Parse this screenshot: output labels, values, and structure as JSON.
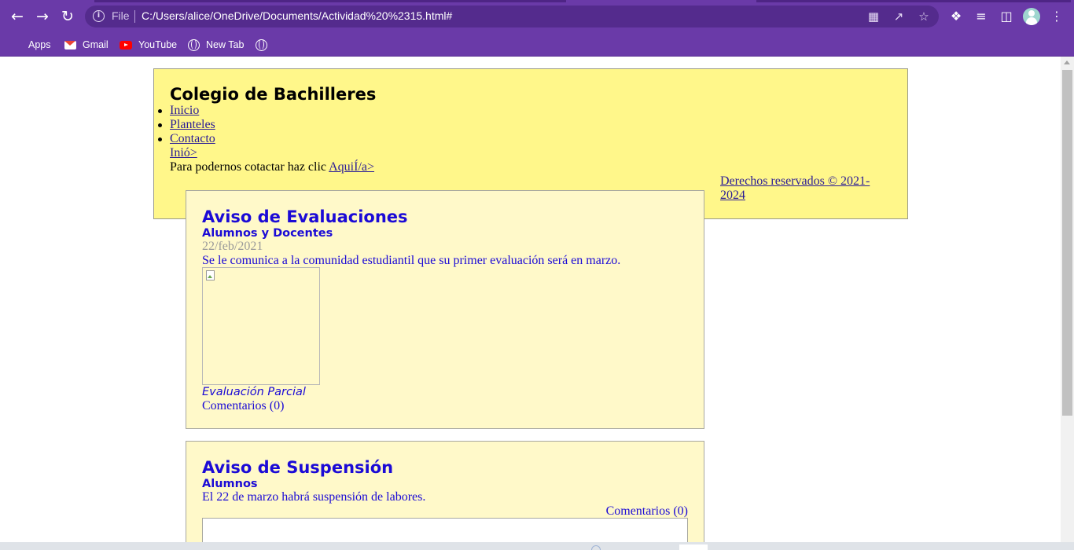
{
  "browser": {
    "file_label": "File",
    "url": "C:/Users/alice/OneDrive/Documents/Actividad%20%2315.html#",
    "bookmarks": [
      {
        "label": "Apps",
        "icon": "apps-grid-icon"
      },
      {
        "label": "Gmail",
        "icon": "gmail-icon"
      },
      {
        "label": "YouTube",
        "icon": "youtube-icon"
      },
      {
        "label": "New Tab",
        "icon": "globe-icon"
      },
      {
        "label": "",
        "icon": "globe-icon"
      }
    ],
    "accent_color": "#6a3aa8"
  },
  "header": {
    "title": "Colegio de Bachilleres",
    "nav": [
      {
        "label": "Inicio"
      },
      {
        "label": "Planteles"
      },
      {
        "label": "Contacto"
      }
    ],
    "inio_link": "Inió>",
    "contact_text": "Para podernos cotactar haz clic ",
    "contact_link": "AquiÍ/a>",
    "copyright": "Derechos reservados © 2021-2024",
    "background": "#fff78a"
  },
  "posts": [
    {
      "title": "Aviso de Evaluaciones",
      "audience": "Alumnos y Docentes",
      "date": "22/feb/2021",
      "body": "Se le comunica a la comunidad estudiantil que su primer evaluación será en marzo.",
      "caption": "Evaluación Parcial",
      "comments": "Comentarios (0)"
    },
    {
      "title": "Aviso de Suspensión",
      "audience": "Alumnos",
      "body": "El 22 de marzo habrá suspensión de labores.",
      "comments": "Comentarios (0)"
    }
  ]
}
